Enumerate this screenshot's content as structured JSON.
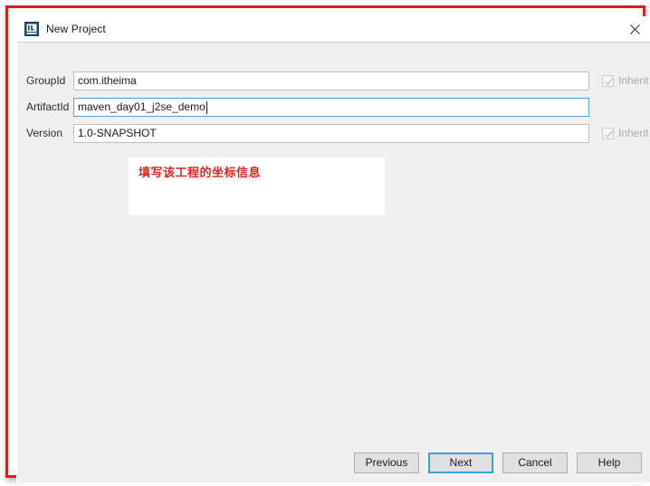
{
  "window": {
    "title": "New Project",
    "icon": "intellij-idea-icon",
    "close_label": "✕"
  },
  "form": {
    "fields": [
      {
        "name": "groupid",
        "label": "GroupId",
        "value": "com.itheima",
        "placeholder": "",
        "focused": false,
        "inherit": {
          "label": "Inherit",
          "checked": true,
          "disabled": true
        }
      },
      {
        "name": "artifactid",
        "label": "ArtifactId",
        "value": "maven_day01_j2se_demo",
        "placeholder": "",
        "focused": true,
        "inherit": null
      },
      {
        "name": "version",
        "label": "Version",
        "value": "1.0-SNAPSHOT",
        "placeholder": "",
        "focused": false,
        "inherit": {
          "label": "Inherit",
          "checked": true,
          "disabled": true
        }
      }
    ]
  },
  "annotation": {
    "text": "填写该工程的坐标信息",
    "color": "#e0231b",
    "frame_color": "#e01b1b"
  },
  "footer": {
    "buttons": [
      {
        "name": "previous",
        "label": "Previous",
        "default": false
      },
      {
        "name": "next",
        "label": "Next",
        "default": true
      },
      {
        "name": "cancel",
        "label": "Cancel",
        "default": false
      },
      {
        "name": "help",
        "label": "Help",
        "default": false
      }
    ]
  }
}
